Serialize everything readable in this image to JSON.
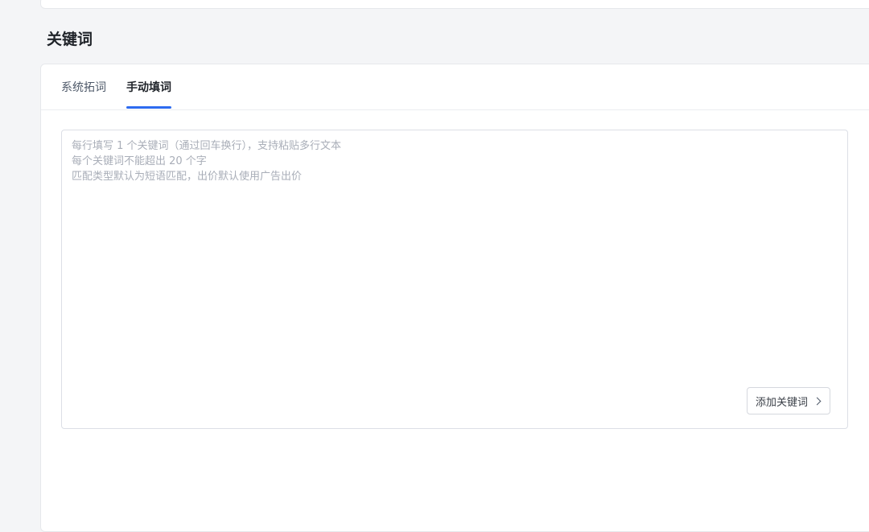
{
  "section": {
    "title": "关键词"
  },
  "tabs": [
    {
      "label": "系统拓词",
      "active": false
    },
    {
      "label": "手动填词",
      "active": true
    }
  ],
  "keyword_input": {
    "value": "",
    "placeholder": "每行填写 1 个关键词（通过回车换行），支持粘贴多行文本\n每个关键词不能超出 20 个字\n匹配类型默认为短语匹配，出价默认使用广告出价"
  },
  "add_button": {
    "label": "添加关键词",
    "icon": "chevron-right-icon"
  },
  "colors": {
    "accent": "#2e6bf0",
    "background": "#f4f5f7",
    "card": "#ffffff",
    "placeholder": "#a9aeb8"
  }
}
